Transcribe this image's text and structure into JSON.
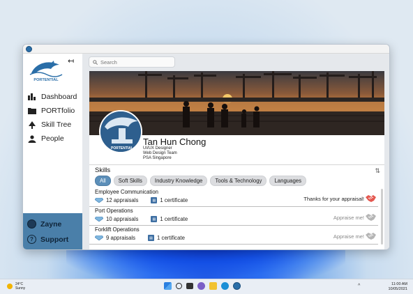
{
  "window": {
    "title": ""
  },
  "sidebar": {
    "logo_text": "PORTENTIAL",
    "collapse_glyph": "↤",
    "items": [
      {
        "label": "Dashboard",
        "icon": "bar-chart-icon"
      },
      {
        "label": "PORTfolio",
        "icon": "folder-icon"
      },
      {
        "label": "Skill Tree",
        "icon": "tree-icon"
      },
      {
        "label": "People",
        "icon": "people-icon"
      }
    ],
    "user_name": "Zayne",
    "support_label": "Support"
  },
  "search": {
    "placeholder": "Search"
  },
  "profile": {
    "name": "Tan Hun Chong",
    "role": "UI/UX Designer",
    "team": "Web Design Team",
    "org": "PSA Singapore",
    "avatar_text": "PORTENTIAL"
  },
  "skills": {
    "title": "Skills",
    "sort_glyph": "⇅",
    "tabs": [
      "All",
      "Soft Skills",
      "Industry Knowledge",
      "Tools & Technology",
      "Languages"
    ],
    "active_tab": "All",
    "rows": [
      {
        "title": "Employee Communication",
        "appraisals": "12 appraisals",
        "certificates": "1 certificate",
        "action": "Thanks for your appraisal!",
        "action_state": "appraised"
      },
      {
        "title": "Port Operations",
        "appraisals": "10 appraisals",
        "certificates": "1 certificate",
        "action": "Appraise me!",
        "action_state": "not-appraised"
      },
      {
        "title": "Forklift Operations",
        "appraisals": "9 appraisals",
        "certificates": "1 certificate",
        "action": "Appraise me!",
        "action_state": "not-appraised"
      }
    ]
  },
  "taskbar": {
    "temperature": "24°C",
    "weather": "Sunny",
    "time": "11:00 AM",
    "date": "10/05/2021"
  },
  "colors": {
    "accent": "#5c8fb9",
    "sidebar_bottom": "#4a7fa9",
    "appraised": "#e4574f",
    "not_appraised": "#b5b5b5"
  }
}
